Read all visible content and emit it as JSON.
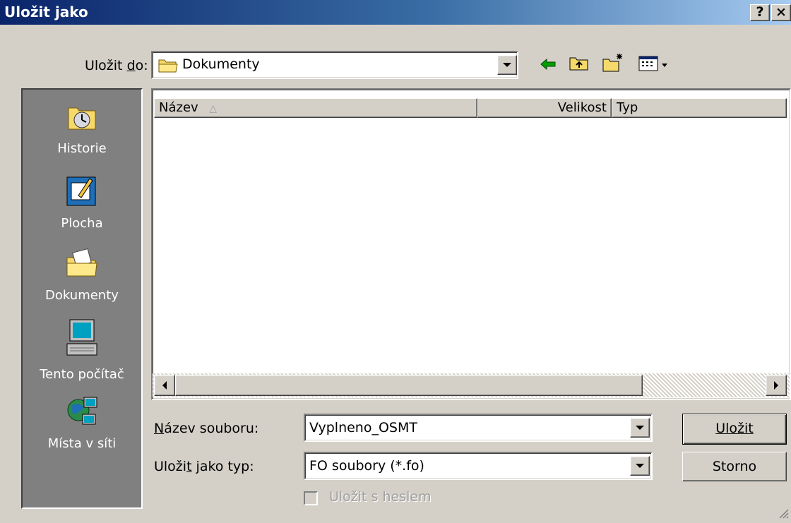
{
  "window": {
    "title": "Uložit jako",
    "help_label": "?",
    "close_label": "×"
  },
  "toolbar": {
    "save_in_label": "Uložit do:",
    "location_value": "Dokumenty",
    "icons": [
      "back-arrow-icon",
      "up-folder-icon",
      "new-folder-icon",
      "view-menu-icon"
    ]
  },
  "places": [
    {
      "label": "Historie",
      "icon": "history-icon"
    },
    {
      "label": "Plocha",
      "icon": "desktop-icon"
    },
    {
      "label": "Dokumenty",
      "icon": "documents-icon"
    },
    {
      "label": "Tento počítač",
      "icon": "my-computer-icon"
    },
    {
      "label": "Místa v síti",
      "icon": "network-places-icon"
    }
  ],
  "list": {
    "columns": [
      {
        "label": "Název",
        "sorted": "asc"
      },
      {
        "label": "Velikost"
      },
      {
        "label": "Typ"
      }
    ],
    "rows": []
  },
  "form": {
    "filename_label": "Název souboru:",
    "filename_value": "Vyplneno_OSMT",
    "filetype_label": "Uložit jako typ:",
    "filetype_value": "FO soubory (*.fo)",
    "password_label": "Uložit s heslem",
    "password_checked": false,
    "password_enabled": false
  },
  "buttons": {
    "save_label": "Uložit",
    "cancel_label": "Storno"
  }
}
